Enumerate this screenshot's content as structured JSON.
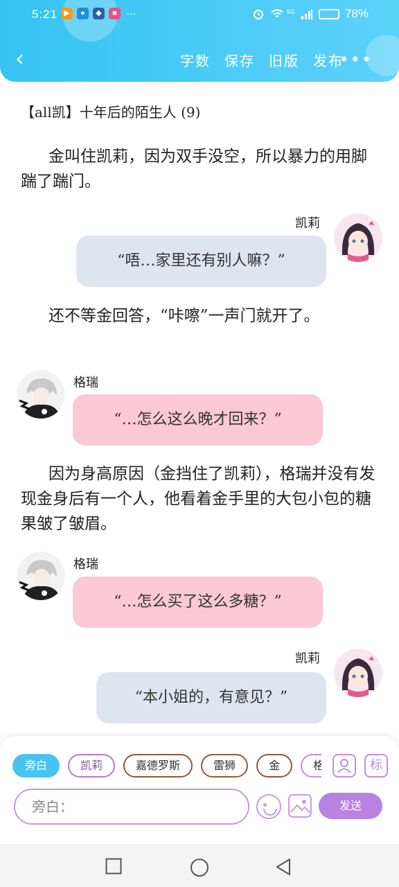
{
  "status_bar": {
    "time": "5:21",
    "dots": "···",
    "signal_label": "5G",
    "battery": "78%"
  },
  "header": {
    "nav_items": [
      "字数",
      "保存",
      "旧版",
      "发布"
    ],
    "more": "•••"
  },
  "story": {
    "title": "【all凯】十年后的陌生人 (9)",
    "blocks": [
      {
        "type": "narration",
        "text": "金叫住凯莉，因为双手没空，所以暴力的用脚踹了踹门。"
      },
      {
        "type": "dialogue",
        "speaker": "凯莉",
        "side": "right",
        "text": "“唔…家里还有别人嘛？”"
      },
      {
        "type": "narration",
        "text": "还不等金回答，“咔嚓”一声门就开了。"
      },
      {
        "type": "dialogue",
        "speaker": "格瑞",
        "side": "left",
        "text": "“…怎么这么晚才回来？”"
      },
      {
        "type": "narration",
        "text": "因为身高原因（金挡住了凯莉），格瑞并没有发现金身后有一个人，他看着金手里的大包小包的糖果皱了皱眉。"
      },
      {
        "type": "dialogue",
        "speaker": "格瑞",
        "side": "left",
        "text": "“…怎么买了这么多糖？”"
      },
      {
        "type": "dialogue",
        "speaker": "凯莉",
        "side": "right",
        "text": "“本小姐的，有意见？”"
      }
    ]
  },
  "composer": {
    "chips": [
      "旁白",
      "凯莉",
      "嘉德罗斯",
      "雷狮",
      "金",
      "格"
    ],
    "active_chip": "旁白",
    "tag_button": "标",
    "input_placeholder": "旁白：",
    "send_label": "发送"
  },
  "colors": {
    "header": "#35c3f2",
    "bubble_kaili": "#dfe5ef",
    "bubble_gerui": "#fbc8d5",
    "send": "#b882e0"
  }
}
